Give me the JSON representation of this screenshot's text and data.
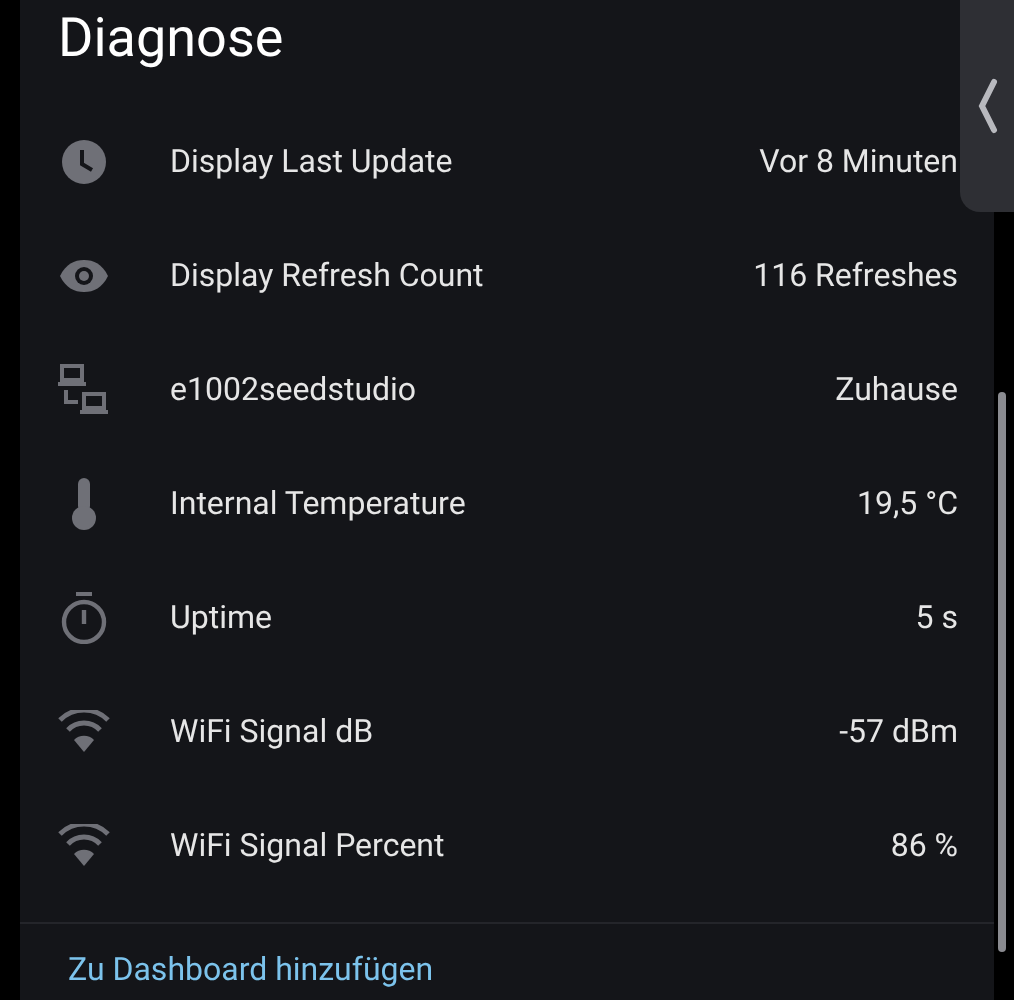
{
  "title": "Diagnose",
  "rows": [
    {
      "label": "Display Last Update",
      "value": "Vor 8 Minuten"
    },
    {
      "label": "Display Refresh Count",
      "value": "116 Refreshes"
    },
    {
      "label": "e1002seedstudio",
      "value": "Zuhause"
    },
    {
      "label": "Internal Temperature",
      "value": "19,5 °C"
    },
    {
      "label": "Uptime",
      "value": "5 s"
    },
    {
      "label": "WiFi Signal dB",
      "value": "-57 dBm"
    },
    {
      "label": "WiFi Signal Percent",
      "value": "86 %"
    }
  ],
  "link": "Zu Dashboard hinzufügen"
}
